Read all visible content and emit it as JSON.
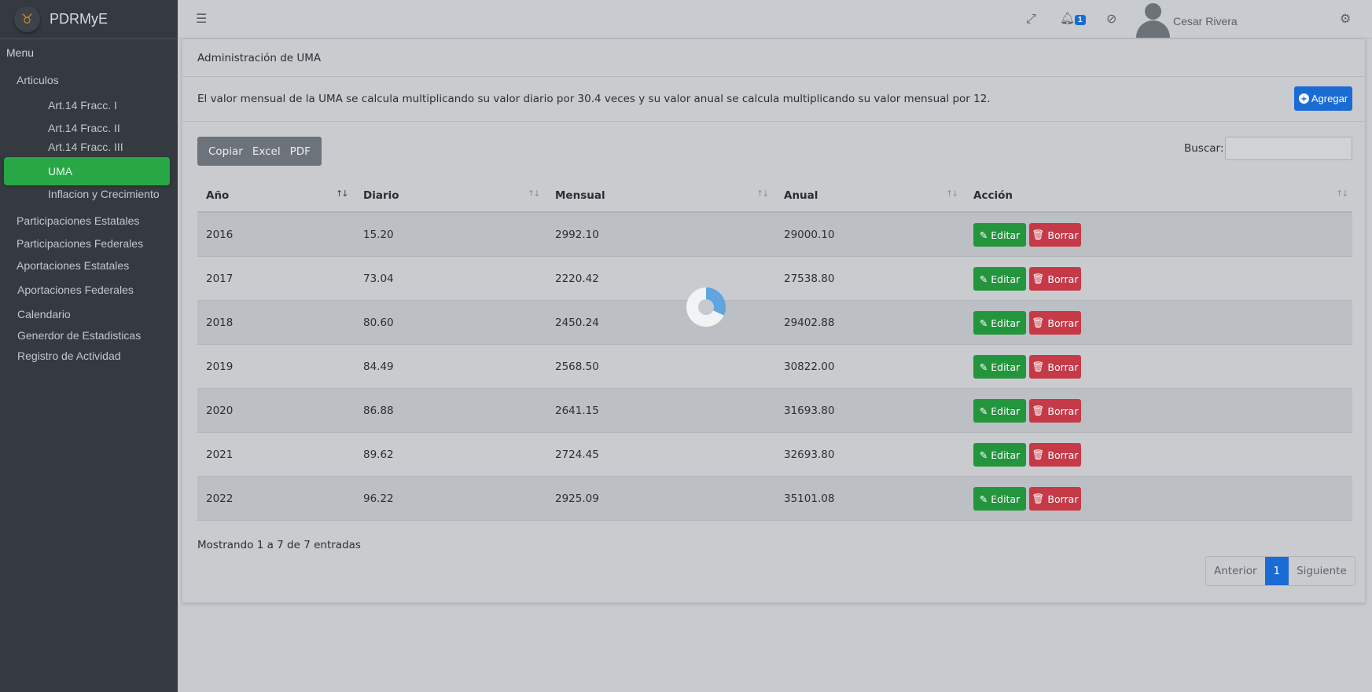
{
  "app": {
    "brand": "PDRMyE",
    "logo_glyph": "♉"
  },
  "sidebar": {
    "menu_header": "Menu",
    "items": [
      {
        "label": "Articulos"
      },
      {
        "label": "Art.14 Fracc. I"
      },
      {
        "label": "Art.14 Fracc. II"
      },
      {
        "label": "Art.14 Fracc. III"
      },
      {
        "label": "UMA",
        "active": true
      },
      {
        "label": "Inflacion y Crecimiento"
      },
      {
        "label": "Participaciones Estatales"
      },
      {
        "label": "Participaciones Federales"
      },
      {
        "label": "Aportaciones Estatales"
      },
      {
        "label": "Aportaciones Federales"
      },
      {
        "label": "Calendario"
      },
      {
        "label": "Generdor de Estadisticas"
      },
      {
        "label": "Registro de Actividad"
      }
    ]
  },
  "topbar": {
    "notification_count": "1",
    "user_name": "Cesar Rivera",
    "icons": [
      "menu-icon",
      "fullscreen-icon",
      "bell-icon",
      "block-icon",
      "user-avatar",
      "settings-icon"
    ]
  },
  "card": {
    "title": "Administración de UMA",
    "info": "El valor mensual de la UMA se calcula multiplicando su valor diario por 30.4 veces y su valor anual se calcula multiplicando su valor mensual por 12.",
    "add_button": "Agregar"
  },
  "toolbar": {
    "copy": "Copiar",
    "excel": "Excel",
    "pdf": "PDF",
    "search_label": "Buscar:"
  },
  "table": {
    "headers": [
      "Año",
      "Diario",
      "Mensual",
      "Anual",
      "Acción"
    ],
    "rows": [
      [
        "2016",
        "15.20",
        "2992.10",
        "29000.10"
      ],
      [
        "2017",
        "73.04",
        "2220.42",
        "27538.80"
      ],
      [
        "2018",
        "80.60",
        "2450.24",
        "29402.88"
      ],
      [
        "2019",
        "84.49",
        "2568.50",
        "30822.00"
      ],
      [
        "2020",
        "86.88",
        "2641.15",
        "31693.80"
      ],
      [
        "2021",
        "89.62",
        "2724.45",
        "32693.80"
      ],
      [
        "2022",
        "96.22",
        "2925.09",
        "35101.08"
      ]
    ],
    "edit_label": "Editar",
    "delete_label": "Borrar"
  },
  "footer": {
    "info": "Mostrando 1 a 7 de 7 entradas",
    "prev": "Anterior",
    "page": "1",
    "next": "Siguiente"
  },
  "colors": {
    "accent": "#1a6bd4",
    "active": "#28a745",
    "danger": "#c63a48",
    "sidebar": "#343a40"
  }
}
